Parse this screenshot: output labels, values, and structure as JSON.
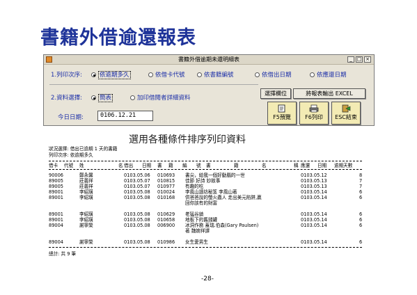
{
  "slide": {
    "title": "書籍外借逾還報表",
    "subtitle": "選用各種條件排序列印資料",
    "page_number": "-28-"
  },
  "window": {
    "title": "書籍外借逾期未還明細表",
    "min_label": "_",
    "max_label": "□",
    "close_label": "×"
  },
  "form": {
    "sort_label": "1.列印次序:",
    "sort_options": [
      "依逾期多久",
      "依借卡代號",
      "依書籍編號",
      "依借出日期",
      "依應還日期"
    ],
    "sort_selected": 0,
    "data_label": "2.資料選擇:",
    "data_options": [
      "簡表",
      "加印借閱者詳細資料"
    ],
    "data_selected": 0,
    "date_label": "今日日期:",
    "date_value": "0106.12.21",
    "config_button": "選擇欄位",
    "excel_button": "將報表輸出 EXCEL",
    "f5_button": "F5預覽",
    "f6_button": "F6列印",
    "esc_button": "ESC結束",
    "f5_icon": "preview-icon",
    "f6_icon": "printer-icon",
    "esc_icon": "exit-icon"
  },
  "report": {
    "condition_line": "狀況選擇: 借出已逾期 1 天的書籍",
    "order_line": "列印次序: 依逾期多久",
    "headers": [
      "借卡",
      "代號",
      "姓",
      "名",
      "借出",
      "日期",
      "書",
      "籍",
      "編",
      "號",
      "書",
      "籍",
      "名",
      "稱",
      "應還",
      "日期",
      "逾期天數"
    ],
    "rows": [
      {
        "card": "90006",
        "name": "鄭永馨",
        "out": "0103.05.06",
        "book": "010693",
        "title": "書尖，給我一個好動腦的一世",
        "due": "0103.05.12",
        "days": "8"
      },
      {
        "card": "89005",
        "name": "莊義祥",
        "out": "0103.05.07",
        "book": "010815",
        "title": "佳節 好詩 妙故事",
        "due": "0103.05.13",
        "days": "7"
      },
      {
        "card": "89005",
        "name": "莊義祥",
        "out": "0103.05.07",
        "book": "010977",
        "title": "有趣的吃",
        "due": "0103.05.13",
        "days": "7"
      },
      {
        "card": "89001",
        "name": "李紹璜",
        "out": "0103.05.08",
        "book": "010024",
        "title": "李風山讀坊秘笈  李風山著",
        "due": "0103.05.14",
        "days": "6"
      },
      {
        "card": "89001",
        "name": "李紹璜",
        "out": "0103.05.08",
        "book": "010168",
        "title": "供爸爸說的螢火蟲人 走出美元陷阱,贏",
        "title2": "回你該有的財富",
        "due": "0103.05.14",
        "days": "6"
      },
      {
        "card": "89001",
        "name": "李紹璜",
        "out": "0103.05.08",
        "book": "010629",
        "title": "老猛谷鎮",
        "due": "0103.05.14",
        "days": "6"
      },
      {
        "card": "89001",
        "name": "李紹璜",
        "out": "0103.05.08",
        "book": "010658",
        "title": "地板下的舊錢罐",
        "due": "0103.05.14",
        "days": "6"
      },
      {
        "card": "89004",
        "name": "謝寧榮",
        "out": "0103.05.08",
        "book": "006900",
        "title": "冰洞作務 蓋瑞.伯森(Gary Paulsen)",
        "title2": "著 魏婉祥譯",
        "due": "0103.05.14",
        "days": "6"
      },
      {
        "card": "89004",
        "name": "謝寧榮",
        "out": "0103.05.08",
        "book": "010986",
        "title": "女生愛男生",
        "due": "0103.05.14",
        "days": "6"
      }
    ],
    "total_line": "總計: 共 9 筆"
  }
}
